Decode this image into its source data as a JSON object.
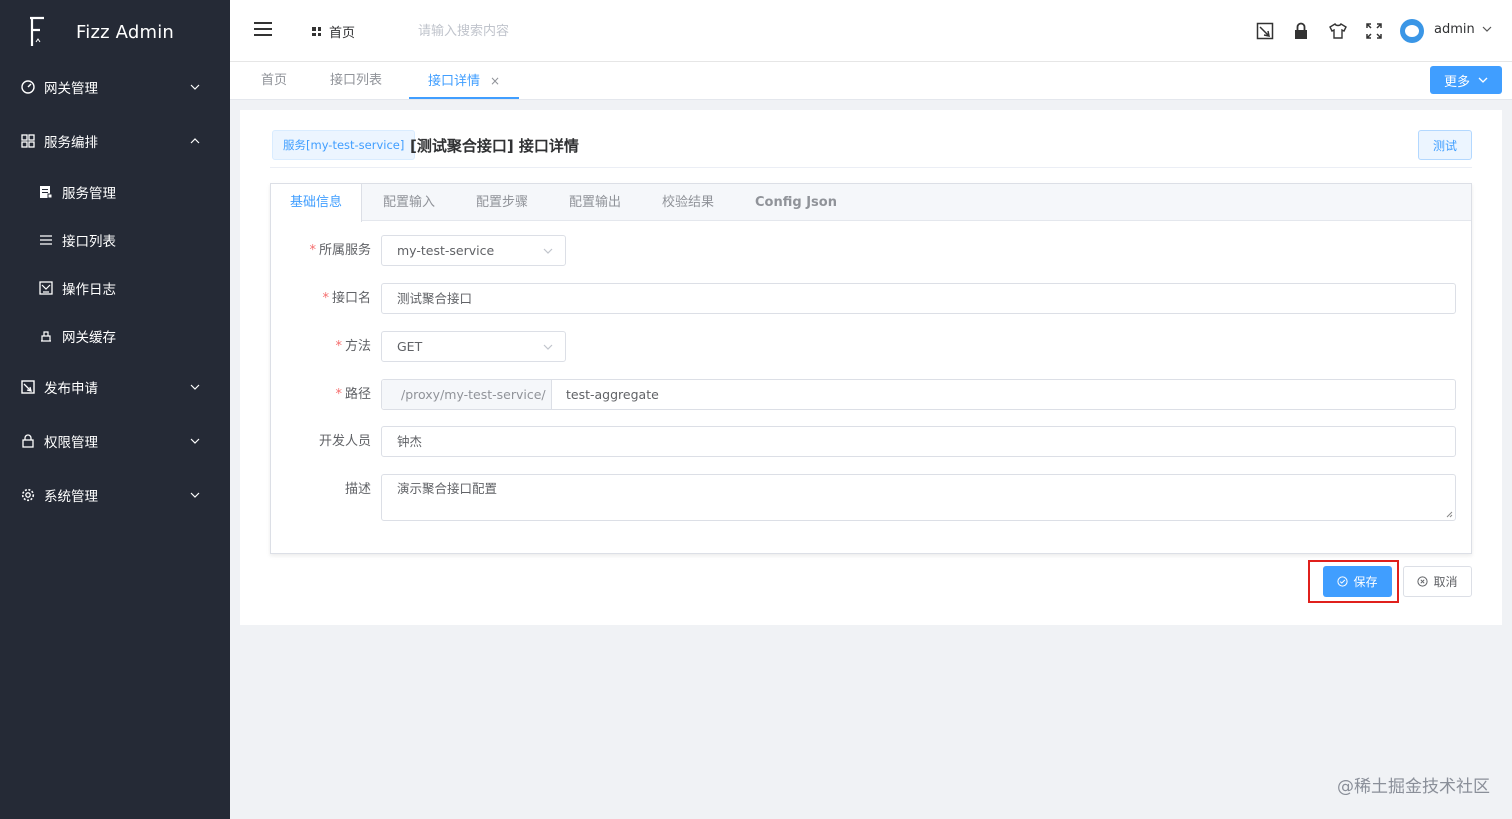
{
  "app": {
    "title": "Fizz Admin"
  },
  "sidebar": {
    "items": [
      {
        "label": "网关管理",
        "icon": "dashboard-icon",
        "expanded": false
      },
      {
        "label": "服务编排",
        "icon": "grid-icon",
        "expanded": true,
        "children": [
          {
            "label": "服务管理",
            "icon": "document-icon"
          },
          {
            "label": "接口列表",
            "icon": "list-icon"
          },
          {
            "label": "操作日志",
            "icon": "log-icon"
          },
          {
            "label": "网关缓存",
            "icon": "cache-icon"
          }
        ]
      },
      {
        "label": "发布申请",
        "icon": "publish-icon",
        "expanded": false
      },
      {
        "label": "权限管理",
        "icon": "lock-icon",
        "expanded": false
      },
      {
        "label": "系统管理",
        "icon": "gear-icon",
        "expanded": false
      }
    ]
  },
  "header": {
    "home_label": "首页",
    "search_placeholder": "请输入搜索内容",
    "user_name": "admin"
  },
  "page_tabs": [
    {
      "label": "首页"
    },
    {
      "label": "接口列表"
    },
    {
      "label": "接口详情",
      "active": true
    }
  ],
  "more_label": "更多",
  "detail": {
    "service_tag": "服务[my-test-service]",
    "title": "[测试聚合接口] 接口详情",
    "test_label": "测试"
  },
  "inner_tabs": [
    {
      "label": "基础信息",
      "active": true
    },
    {
      "label": "配置输入"
    },
    {
      "label": "配置步骤"
    },
    {
      "label": "配置输出"
    },
    {
      "label": "校验结果"
    },
    {
      "label": "Config Json"
    }
  ],
  "form": {
    "service": {
      "label": "所属服务",
      "value": "my-test-service",
      "required": true
    },
    "name": {
      "label": "接口名",
      "value": "测试聚合接口",
      "required": true
    },
    "method": {
      "label": "方法",
      "value": "GET",
      "required": true
    },
    "path": {
      "label": "路径",
      "prefix": "/proxy/my-test-service/",
      "value": "test-aggregate",
      "required": true
    },
    "developer": {
      "label": "开发人员",
      "value": "钟杰",
      "required": false
    },
    "description": {
      "label": "描述",
      "value": "演示聚合接口配置",
      "required": false
    }
  },
  "actions": {
    "save_label": "保存",
    "cancel_label": "取消"
  },
  "watermark": "@稀土掘金技术社区",
  "colors": {
    "sidebar_bg": "#252a36",
    "primary": "#409eff",
    "highlight": "#e0201c"
  }
}
